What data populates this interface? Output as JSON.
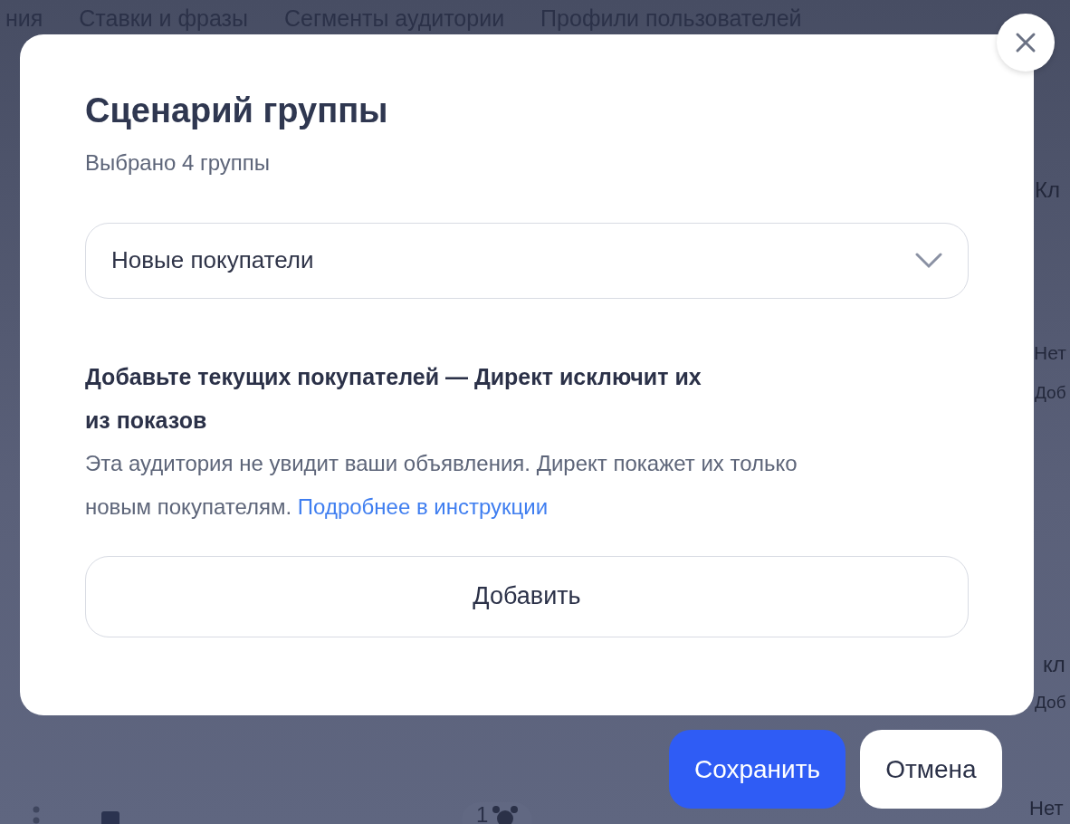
{
  "background": {
    "tabs": [
      "ния",
      "Ставки и фразы",
      "Сегменты аудитории",
      "Профили пользователей"
    ],
    "side_texts": [
      "Кл",
      "Нет",
      "Доб",
      "кл",
      "Доб",
      "Нет"
    ],
    "counter": "1"
  },
  "dialog": {
    "title": "Сценарий группы",
    "subtitle": "Выбрано 4 группы",
    "select": {
      "value": "Новые покупатели"
    },
    "hint": {
      "heading": "Добавьте текущих покупателей — Директ исключит их из показов",
      "body": "Эта аудитория не увидит ваши объявления. Директ покажет их только новым покупателям.",
      "link": "Подробнее в инструкции"
    },
    "add_button": "Добавить"
  },
  "buttons": [
    {
      "label": "Сохранить",
      "kind": "primary"
    },
    {
      "label": "Отмена",
      "kind": "secondary"
    }
  ]
}
